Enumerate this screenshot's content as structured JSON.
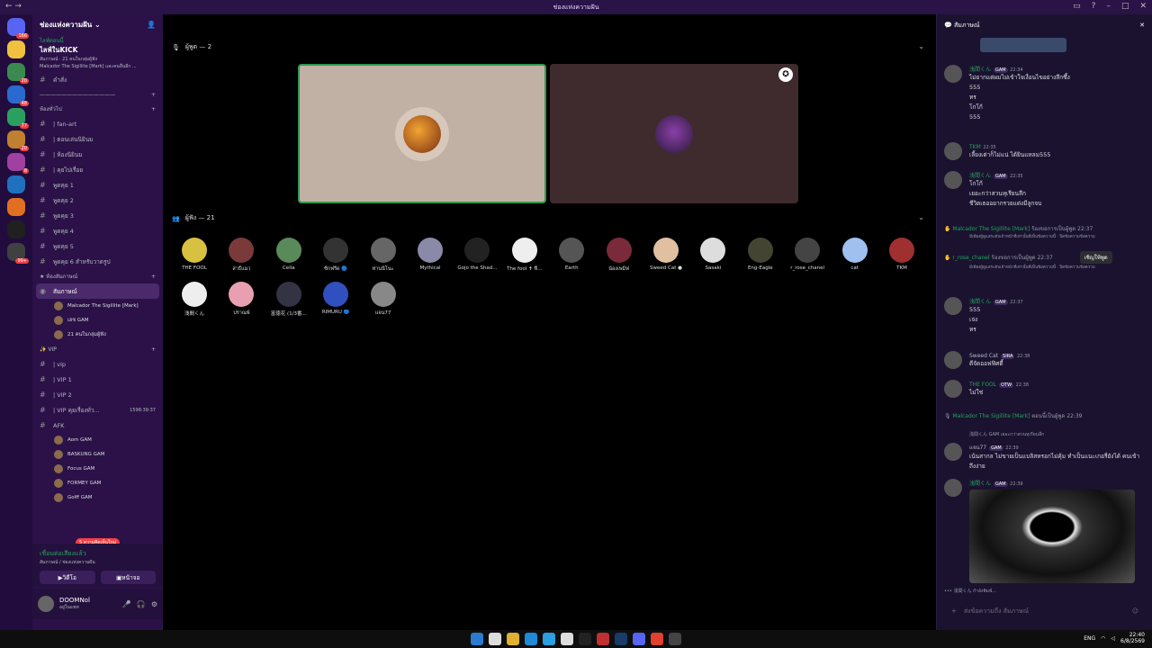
{
  "titlebar": {
    "title": "ช่องแห่งความฝัน"
  },
  "server_badges": [
    "166",
    "",
    "20",
    "48",
    "77",
    "20",
    "8",
    "",
    "",
    "",
    "99+"
  ],
  "sidebar": {
    "guild_name": "ช่องแห่งความฝัน",
    "event": {
      "live": "ไลฟ์ตอนนี้",
      "name": "ไลฟ์ในKICK",
      "sub1": "สัมภาษณ์ · 21 คนในกลุ่มผู้ฟัง",
      "sub2": "Malcador The Sigillite [Mark] และคนอื่นอีก ..."
    },
    "top_channel": "คำสั่ง",
    "divider": "——————————————",
    "cat_rooms": "ห้องทั่วไป",
    "text_channels": [
      "| fan-art",
      "| ตอนเล่นนิยินม",
      "| ห้องนิยินม",
      "| คุยไปเรื่อย",
      "พูดคุย 1",
      "พูดคุย 2",
      "พูดคุย 3",
      "พูดคุย 4",
      "พูดคุย 5",
      "พูดคุย 6 สำหรับวาดรูป"
    ],
    "cat_stage": "ห้องสัมภาษณ์",
    "stage_channel": {
      "name": "สัมภาษณ์",
      "sub": "ไลฟ์ในKICK"
    },
    "stage_members": [
      "Malcador The Sigillite [Mark]",
      "เฮช  GAM",
      "21 คนในกลุ่มผู้ฟัง"
    ],
    "cat_vip": "VIP",
    "vip_channels": [
      "| vip",
      "| VIP 1",
      "| VIP 2",
      "| VIP คุยเรื่องทั่ว...",
      "AFK"
    ],
    "vip_timer": "1598:39:37",
    "vip_members": [
      "Aom  GAM",
      "BASKUNG  GAM",
      "Focus  GAM",
      "FORMEY  GAM",
      "Golff  GAM"
    ],
    "new_unreads": "5 ความคิดเห็นใหม่"
  },
  "voice": {
    "status": "เชื่อมต่อเสียงแล้ว",
    "sub": "สัมภาษณ์ / ช่องแห่งความฝัน",
    "video": "วิดีโอ",
    "screen": "หน้าจอ"
  },
  "user": {
    "name": "DOOMNol",
    "status": "อยู่ในแชท"
  },
  "main": {
    "speakers_label": "ผู้พูด — 2",
    "listeners_label": "ผู้ฟัง — 21",
    "listeners": [
      "THE FOOL",
      "สาธิ์แมว",
      "Celia",
      "ซิกฟรีด 🔵",
      "ท่านนิโนะ",
      "Mythical",
      "Gojo the Shad...",
      "The fool ✝ ฟี...",
      "Earth",
      "น้องเพมิ่ฟ",
      "Sweed Cat ●",
      "Sasaki",
      "Eng-Eagle",
      "r_rose_chanel",
      "cat",
      "TKM",
      "浅間くん",
      "ปราณพ์",
      "富徳花 (1/3番...",
      "RIMURU 🔵",
      "แจน77"
    ]
  },
  "chat": {
    "title": "สัมภาษณ์",
    "messages": [
      {
        "author": "浅間くん",
        "tag": "GAM",
        "time": "22:34",
        "lines": [
          "ไม่ยากแต่ผมไม่เข้าใจเงื่อนไขอย่างลึกซึ้ง",
          "555",
          "ทร",
          "โกโก้",
          "555"
        ],
        "color": "#23a55a"
      },
      {
        "author": "TKM",
        "time": "22:35",
        "lines": [
          "เลี้ยงเต่าก็ไม่แน่ ได้ยินแหลม555"
        ],
        "color": "#23a55a"
      },
      {
        "author": "浅間くん",
        "tag": "GAM",
        "time": "22:35",
        "lines": [
          "โกโก้",
          "เยอะกว่าสวนหุเรียนลึก",
          "ชีวิตเธออยากรวยแต่งมีลูกจบ"
        ],
        "color": "#23a55a"
      },
      {
        "author": "浅間くん",
        "tag": "GAM",
        "time": "22:37",
        "lines": [
          "555",
          "เจ่ง",
          "ทร"
        ],
        "color": "#23a55a"
      },
      {
        "author": "Sweed Cat",
        "tag": "SIRA",
        "time": "22:38",
        "lines": [
          "ดีจัดออฟฟิศตี้"
        ],
        "color": "#b5bac1"
      },
      {
        "author": "THE FOOL",
        "tag": "OTW",
        "time": "22:38",
        "lines": [
          "ไม่ใช่"
        ],
        "color": "#23a55a"
      },
      {
        "author": "แจน77",
        "tag": "GAM",
        "time": "22:39",
        "lines": [
          "เน้นสากล ไม่ขายเป็นแบลิสหรอกไม่คุ้ม ทำเป็นแนะเกอรี่ยังได้ คนเข้าถึงง่าย"
        ],
        "color": "#b5bac1"
      },
      {
        "author": "浅間くん",
        "tag": "GAM",
        "time": "22:39",
        "lines": [],
        "color": "#23a55a"
      }
    ],
    "system1": {
      "who": "Malcador The Sigillite [Mark]",
      "text": "ร้องขอการเป็นผู้พูด 22:37",
      "note": "มีเพียงผู้ดูแลระดับเจ้าหน้าที่เท่านั้นที่เห็นข้อความนี้ · ปิดข้อความข้อความ"
    },
    "system2": {
      "who": "r_rose_chanel",
      "text": "ร้องขอการเป็นผู้พูด 22:37",
      "button": "เชิญให้พูด",
      "note": "มีเพียงผู้ดูแลระดับเจ้าหน้าที่เท่านั้นที่เห็นข้อความนี้ · ปิดข้อความข้อความ"
    },
    "system3": {
      "who": "Malcador The Sigillite [Mark]",
      "text": "ตอนนี้เป็นผู้พูด 22:39"
    },
    "reply_ref": "浅間くん GAM เยอะกว่าสวนหุเรียนลึก",
    "typing": "浅間くん กำลังพิมพ์...",
    "composer_placeholder": "ส่งข้อความถึง สัมภาษณ์"
  },
  "tray": {
    "lang": "ENG",
    "time": "22:40",
    "date": "6/8/2569"
  }
}
